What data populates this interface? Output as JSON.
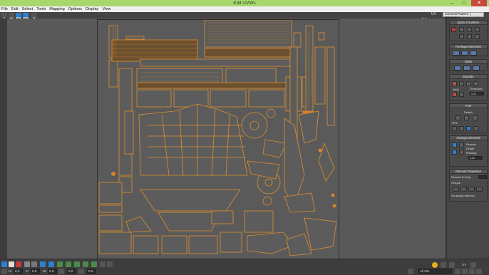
{
  "window": {
    "title": "Edit UVWs",
    "minimize_glyph": "–",
    "maximize_glyph": "□",
    "close_glyph": "✕"
  },
  "menu": [
    "File",
    "Edit",
    "Select",
    "Tools",
    "Mapping",
    "Options",
    "Display",
    "View"
  ],
  "toolbar": {
    "uv_label": "UV",
    "texture_selector": "CheckerPattern ( Checker )"
  },
  "panel": {
    "quick_transform": "Quick Transform",
    "reshape": "Reshape Elements",
    "stitch": "Stitch",
    "explode": "Explode",
    "weld": "Weld",
    "threshold_label": "Threshold:",
    "threshold_value": "0,01",
    "peel": "Peel",
    "detach": "Detach",
    "pins": "Pins:",
    "arrange": "Arrange Elements",
    "rescale": "Rescale",
    "rotate": "Rotate",
    "padding_label": "Padding:",
    "padding_value": "0,02",
    "element_props": "Element Properties",
    "rescale_priority": "Rescale Priority:",
    "groups": "Groups:",
    "no_groups": "No groups selected"
  },
  "bottom": {
    "u_label": "U:",
    "u_value": "0,0",
    "v_label": "V:",
    "v_value": "0,0",
    "w_label": "W:",
    "w_value": "0,0",
    "xy_label": "XY",
    "ids_dropdown": "All IDs",
    "num_1": "0,0",
    "num_2": "0,0"
  },
  "colors": {
    "title_bar": "#a6d86e",
    "uv_edge": "#e0902a",
    "uv_fill": "#5a5a5a",
    "background": "#595959",
    "selection_orange": "#e57b1e",
    "accent_blue": "#2f7fd0"
  }
}
